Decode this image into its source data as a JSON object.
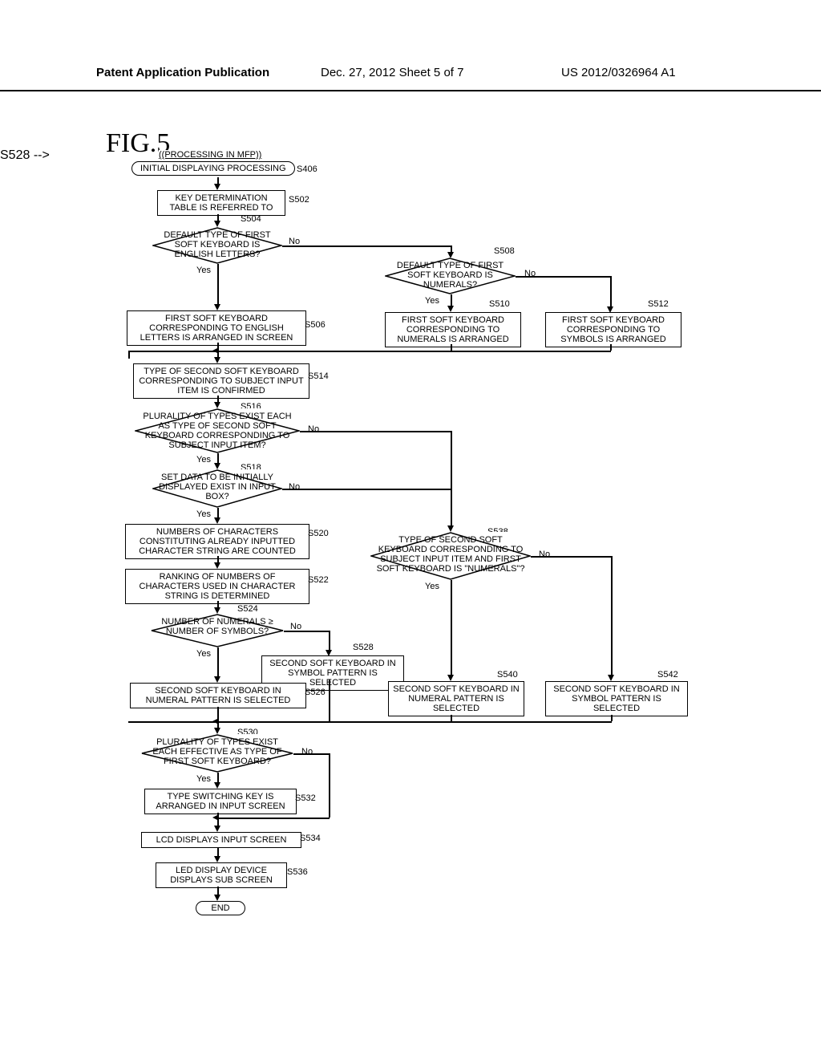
{
  "header": {
    "left": "Patent Application Publication",
    "mid": "Dec. 27, 2012  Sheet 5 of 7",
    "right": "US 2012/0326964 A1"
  },
  "figure_label": "FIG.5",
  "nodes": {
    "t_start_sub": "((PROCESSING IN MFP))",
    "t_start": "INITIAL DISPLAYING PROCESSING",
    "s502": "KEY DETERMINATION TABLE IS REFERRED TO",
    "s504": "DEFAULT TYPE OF FIRST SOFT KEYBOARD IS ENGLISH LETTERS?",
    "s506": "FIRST SOFT KEYBOARD CORRESPONDING TO ENGLISH LETTERS IS ARRANGED IN SCREEN",
    "s508": "DEFAULT TYPE OF FIRST SOFT KEYBOARD IS NUMERALS?",
    "s510": "FIRST SOFT KEYBOARD CORRESPONDING TO NUMERALS IS ARRANGED",
    "s512": "FIRST SOFT KEYBOARD CORRESPONDING TO SYMBOLS IS ARRANGED",
    "s514": "TYPE OF SECOND SOFT KEYBOARD CORRESPONDING TO SUBJECT INPUT ITEM IS CONFIRMED",
    "s516": "PLURALITY OF TYPES EXIST EACH AS TYPE OF SECOND SOFT KEYBOARD CORRESPONDING TO SUBJECT INPUT ITEM?",
    "s518": "SET DATA TO BE INITIALLY DISPLAYED EXIST IN INPUT BOX?",
    "s520": "NUMBERS OF CHARACTERS CONSTITUTING ALREADY INPUTTED CHARACTER STRING ARE COUNTED",
    "s522": "RANKING OF NUMBERS OF CHARACTERS USED IN CHARACTER STRING IS DETERMINED",
    "s524": "NUMBER OF NUMERALS ≥ NUMBER OF SYMBOLS?",
    "s526": "SECOND SOFT KEYBOARD IN NUMERAL PATTERN IS SELECTED",
    "s528": "SECOND SOFT KEYBOARD IN SYMBOL PATTERN IS SELECTED",
    "s538": "TYPE OF SECOND SOFT KEYBOARD CORRESPONDING TO SUBJECT INPUT ITEM AND FIRST SOFT KEYBOARD IS \"NUMERALS\"?",
    "s540": "SECOND SOFT KEYBOARD IN NUMERAL PATTERN IS SELECTED",
    "s542": "SECOND SOFT KEYBOARD IN SYMBOL PATTERN IS SELECTED",
    "s530": "PLURALITY OF TYPES EXIST EACH EFFECTIVE AS TYPE OF FIRST SOFT KEYBOARD?",
    "s532": "TYPE SWITCHING KEY IS ARRANGED IN INPUT SCREEN",
    "s534": "LCD DISPLAYS INPUT SCREEN",
    "s536": "LED DISPLAY DEVICE DISPLAYS SUB SCREEN",
    "t_end": "END"
  },
  "steps": {
    "s406": "S406",
    "s502": "S502",
    "s504": "S504",
    "s506": "S506",
    "s508": "S508",
    "s510": "S510",
    "s512": "S512",
    "s514": "S514",
    "s516": "S516",
    "s518": "S518",
    "s520": "S520",
    "s522": "S522",
    "s524": "S524",
    "s526": "S526",
    "s528": "S528",
    "s530": "S530",
    "s532": "S532",
    "s534": "S534",
    "s536": "S536",
    "s538": "S538",
    "s540": "S540",
    "s542": "S542"
  },
  "labels": {
    "yes": "Yes",
    "no": "No"
  }
}
